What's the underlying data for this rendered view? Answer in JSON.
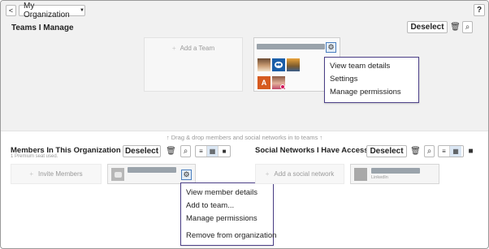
{
  "header": {
    "back_glyph": "<",
    "org_select_label": "My Organization",
    "org_select_caret": "▼",
    "help_label": "?"
  },
  "teams": {
    "title": "Teams I Manage",
    "deselect_label": "Deselect",
    "add_team_label": "Add a Team",
    "add_plus": "+",
    "team_menu": [
      "View team details",
      "Settings",
      "Manage permissions"
    ],
    "avatar_letter": "A"
  },
  "drag_hint": "↑  Drag & drop members and social networks in to teams  ↑",
  "members": {
    "title": "Members In This Organization",
    "seat_note": "1 Premium seat used.",
    "deselect_label": "Deselect",
    "invite_label": "Invite Members",
    "invite_plus": "+",
    "member_menu": [
      "View member details",
      "Add to team...",
      "Manage permissions",
      "Remove from organization"
    ]
  },
  "social": {
    "title": "Social Networks I Have Access To",
    "deselect_label": "Deselect",
    "add_social_label": "Add a social network",
    "add_plus": "+",
    "linkedin_label": "LinkedIn"
  },
  "icons": {
    "trash": "🗑",
    "search": "⌕",
    "gear": "⚙",
    "list": "≡",
    "grid": "▦",
    "square": "■"
  },
  "colors": {
    "menu_border": "#4b3f87",
    "gear_border": "#4a7fc0",
    "top_background": "#f1f1f1"
  }
}
